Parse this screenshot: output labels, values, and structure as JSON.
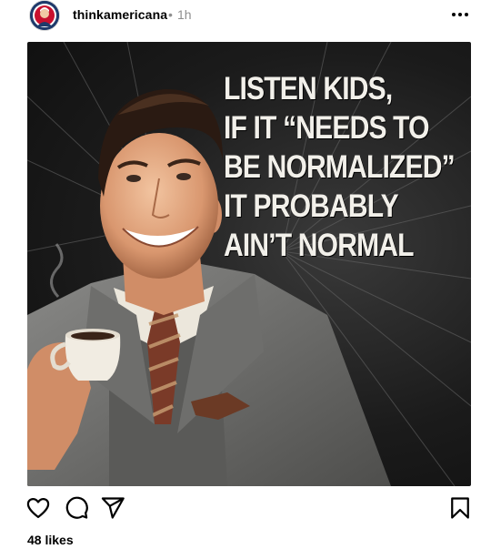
{
  "post": {
    "username": "thinkamericana",
    "separator": "•",
    "timestamp": "1h",
    "more_icon": "more-horizontal-icon",
    "avatar_icon": "avatar"
  },
  "image": {
    "text_lines": [
      "LISTEN KIDS,",
      "IF IT “NEEDS TO",
      "BE NORMALIZED”",
      "IT PROBABLY",
      "AIN’T NORMAL"
    ]
  },
  "actions": {
    "like_icon": "heart-icon",
    "comment_icon": "comment-icon",
    "share_icon": "share-icon",
    "save_icon": "bookmark-icon"
  },
  "likes": {
    "label": "48 likes"
  },
  "colors": {
    "username": "#000000",
    "timestamp": "#8e8e8e",
    "meme_text": "#f2f0ea",
    "background": "#ffffff"
  }
}
